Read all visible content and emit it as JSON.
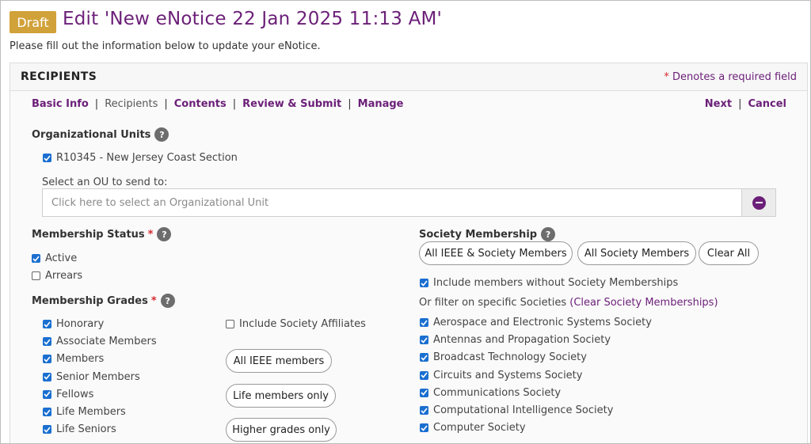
{
  "header": {
    "badge": "Draft",
    "title": "Edit 'New eNotice 22 Jan 2025 11:13 AM'",
    "intro": "Please fill out the information below to update your eNotice."
  },
  "panel": {
    "section_title": "RECIPIENTS",
    "required_star": "*",
    "required_note": "Denotes a required field"
  },
  "nav": {
    "steps": [
      "Basic Info",
      "Recipients",
      "Contents",
      "Review & Submit",
      "Manage"
    ],
    "separator": "|",
    "next": "Next",
    "cancel": "Cancel"
  },
  "org_units": {
    "label": "Organizational Units",
    "help": "?",
    "selected": {
      "label": "R10345 - New Jersey Coast Section",
      "checked": true
    },
    "select_label": "Select an OU to send to:",
    "placeholder": "Click here to select an Organizational Unit"
  },
  "membership_status": {
    "label": "Membership Status",
    "required_star": "*",
    "help": "?",
    "options": [
      {
        "label": "Active",
        "checked": true
      },
      {
        "label": "Arrears",
        "checked": false
      }
    ]
  },
  "membership_grades": {
    "label": "Membership Grades",
    "required_star": "*",
    "help": "?",
    "options": [
      {
        "label": "Honorary",
        "checked": true
      },
      {
        "label": "Associate Members",
        "checked": true
      },
      {
        "label": "Members",
        "checked": true
      },
      {
        "label": "Senior Members",
        "checked": true
      },
      {
        "label": "Fellows",
        "checked": true
      },
      {
        "label": "Life Members",
        "checked": true
      },
      {
        "label": "Life Seniors",
        "checked": true
      }
    ],
    "include_affiliates": {
      "label": "Include Society Affiliates",
      "checked": false
    },
    "buttons": [
      "All IEEE members",
      "Life members only",
      "Higher grades only"
    ]
  },
  "society_membership": {
    "label": "Society Membership",
    "help": "?",
    "buttons": [
      "All IEEE & Society Members",
      "All Society Members",
      "Clear All"
    ],
    "include_without": {
      "label": "Include members without Society Memberships",
      "checked": true
    },
    "filter_text": "Or filter on specific Societies",
    "filter_link": "(Clear Society Memberships)",
    "societies": [
      {
        "label": "Aerospace and Electronic Systems Society",
        "checked": true
      },
      {
        "label": "Antennas and Propagation Society",
        "checked": true
      },
      {
        "label": "Broadcast Technology Society",
        "checked": true
      },
      {
        "label": "Circuits and Systems Society",
        "checked": true
      },
      {
        "label": "Communications Society",
        "checked": true
      },
      {
        "label": "Computational Intelligence Society",
        "checked": true
      },
      {
        "label": "Computer Society",
        "checked": true
      }
    ]
  },
  "colors": {
    "brand_purple": "#6b1f78",
    "draft_gold": "#d1a23a",
    "checkbox_blue": "#1a6fd0",
    "required_red": "#d6282f"
  }
}
